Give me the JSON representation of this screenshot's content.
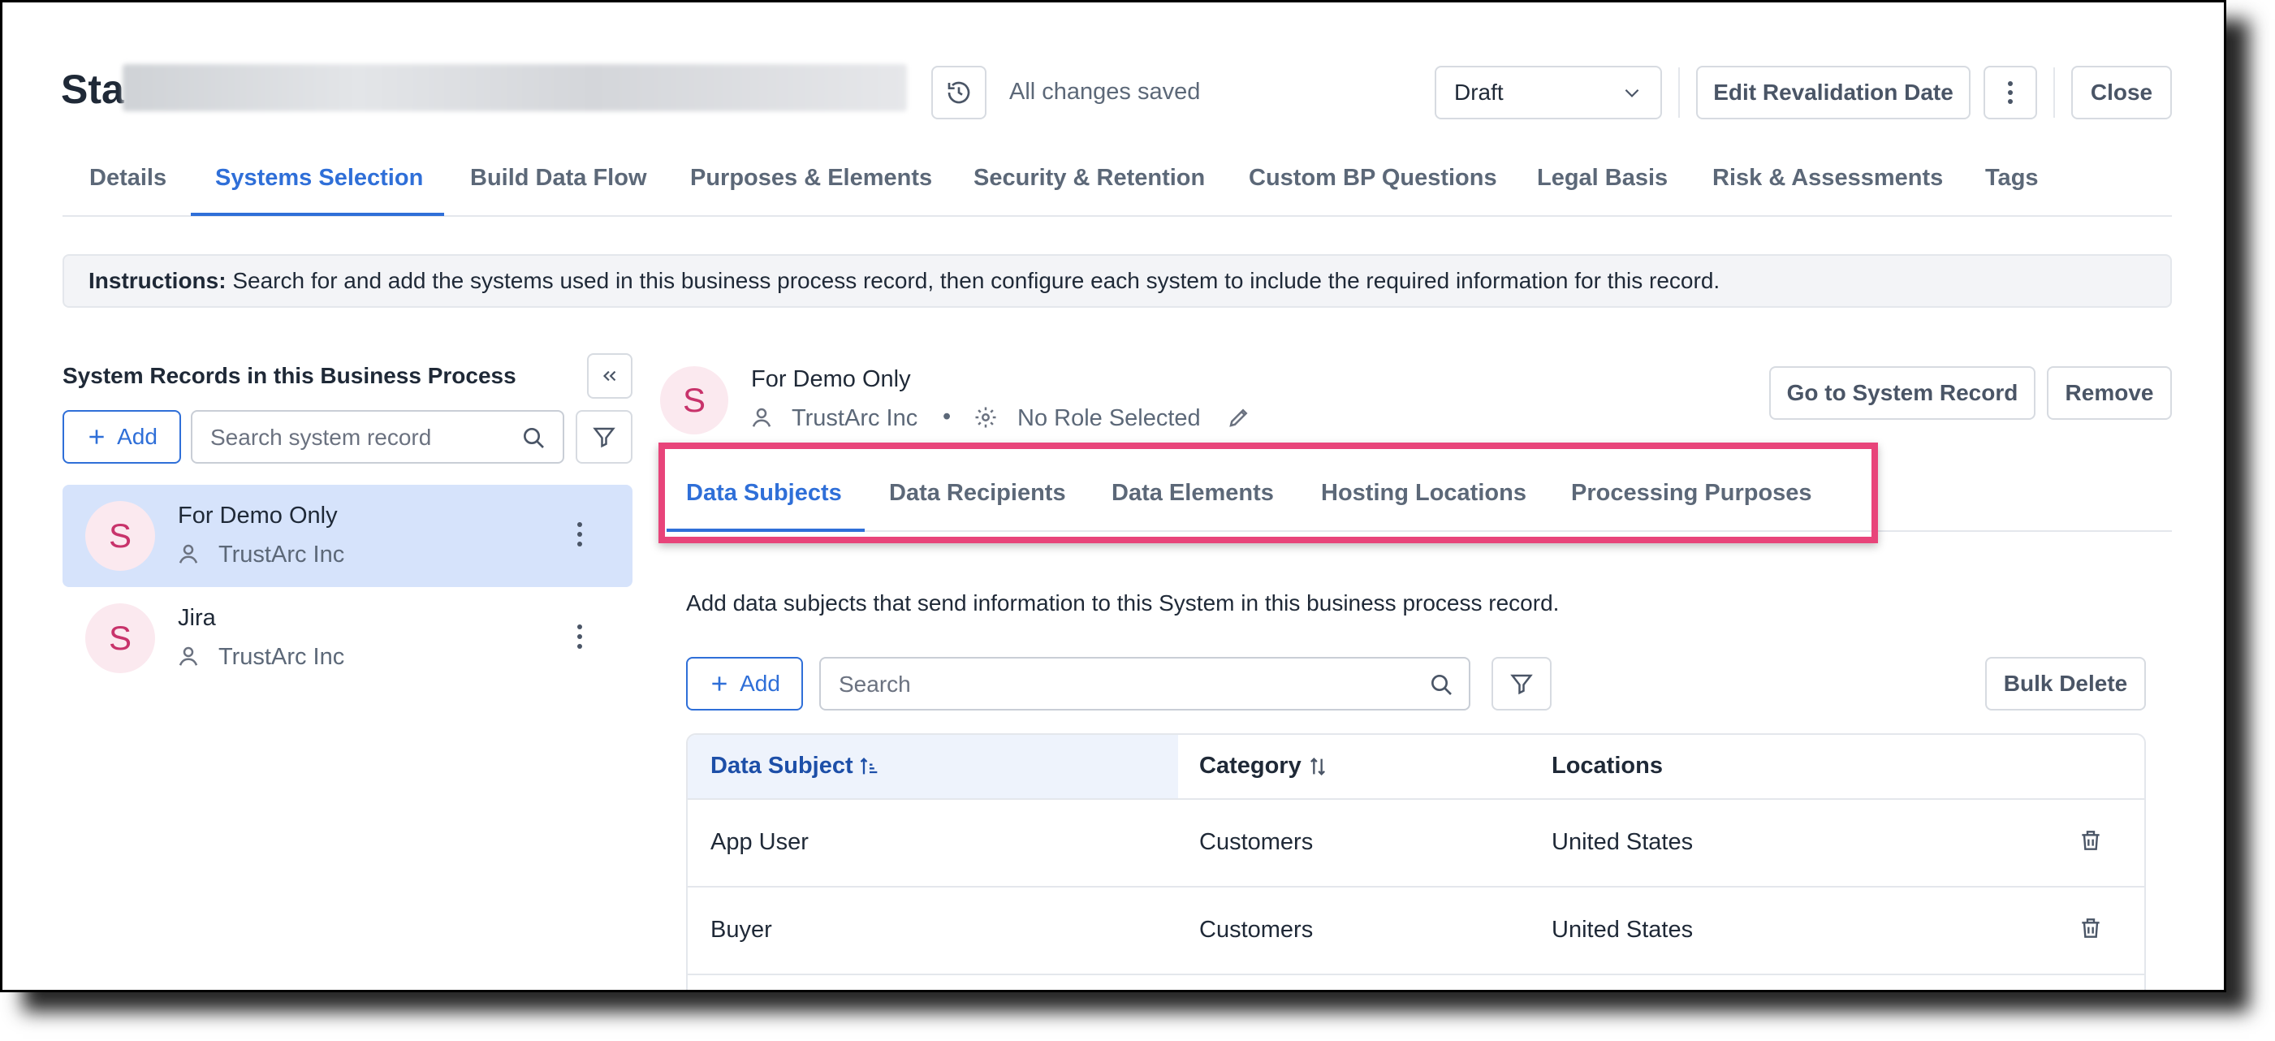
{
  "header": {
    "title_visible": "Sta",
    "save_status": "All changes saved",
    "status_select": "Draft",
    "edit_revalidation": "Edit Revalidation Date",
    "close": "Close"
  },
  "main_tabs": [
    "Details",
    "Systems Selection",
    "Build Data Flow",
    "Purposes & Elements",
    "Security & Retention",
    "Custom BP Questions",
    "Legal Basis",
    "Risk & Assessments",
    "Tags"
  ],
  "instructions": {
    "label": "Instructions:",
    "text": " Search for and add the systems used in this business process record, then configure each system to include the required information for this record."
  },
  "left_panel": {
    "title": "System Records in this Business Process",
    "add_label": "Add",
    "search_placeholder": "Search system record",
    "records": [
      {
        "avatar": "S",
        "name": "For Demo Only",
        "owner": "TrustArc Inc"
      },
      {
        "avatar": "S",
        "name": "Jira",
        "owner": "TrustArc Inc"
      }
    ]
  },
  "detail": {
    "avatar": "S",
    "name": "For Demo Only",
    "owner": "TrustArc Inc",
    "separator": "•",
    "role": "No Role Selected",
    "go_to_record": "Go to System Record",
    "remove": "Remove",
    "sub_tabs": [
      "Data Subjects",
      "Data Recipients",
      "Data Elements",
      "Hosting Locations",
      "Processing Purposes"
    ],
    "description": "Add data subjects that send information to this System in this business process record.",
    "add_label": "Add",
    "search_placeholder": "Search",
    "bulk_delete": "Bulk Delete"
  },
  "table": {
    "columns": [
      "Data Subject",
      "Category",
      "Locations"
    ],
    "rows": [
      {
        "subject": "App User",
        "category": "Customers",
        "location": "United States"
      },
      {
        "subject": "Buyer",
        "category": "Customers",
        "location": "United States"
      }
    ]
  },
  "colors": {
    "accent": "#2f6fd8",
    "highlight": "#e8447a",
    "selected_row": "#d6e3fb",
    "avatar_bg": "#fbe9ef"
  }
}
